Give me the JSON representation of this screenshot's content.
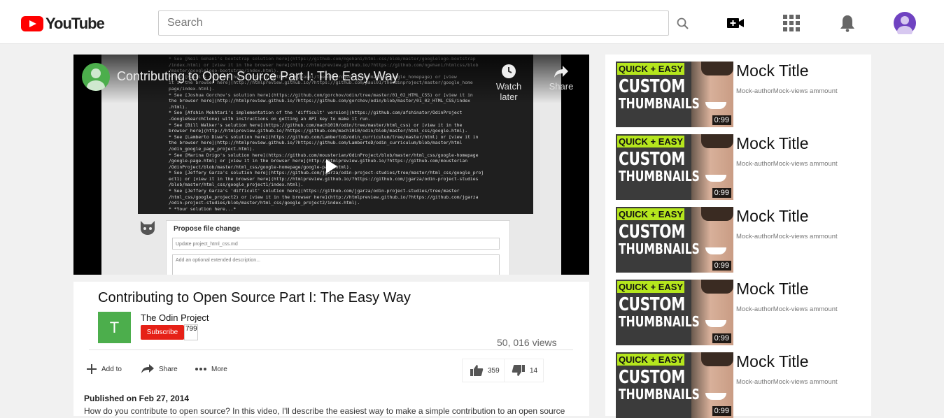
{
  "header": {
    "logo_text": "YouTube",
    "search_placeholder": "Search",
    "icons": [
      "youtube-logo-icon",
      "search-icon",
      "upload-video-icon",
      "apps-grid-icon",
      "notifications-bell-icon",
      "user-avatar-icon"
    ]
  },
  "player": {
    "title": "Contributing to Open Source Part I: The Easy Way",
    "watch_later_label": "Watch later",
    "share_label": "Share",
    "code_lines": [
      "* See [Neil Gehani's bootstrap solution here](https://github.com/ngehani/html-css/blob/master/googlelogo-bootstrap",
      "/index.html) or [view it in the browser here](http://htmlpreview.github.io/?https://github.com/ngehani/htmlcss/blob",
      "/master/googlelogo-bootstrap/index.html).",
      "* See [Pavol's solution here](https://github.com/pavol/theodinproject/tree/master/google_homepage) or [view",
      "it in the browser here](http://htmlpreview.github.io/?https://github.com/paul01/theodinproject/master/google_home",
      "page/index.html).",
      "* See [Joshua Gorchov's solution here](https://github.com/gorchov/odin/tree/master/01_02_HTML_CSS) or [view it in",
      "the browser here](http://htmlpreview.github.io/?https://github.com/gorchov/odin/blob/master/01_02_HTML_CSS/index",
      ".html).",
      "* See [Afshin Mokhtari's implementation of the 'difficult' version](https://github.com/afshinator/OdinProject",
      "-GoogleSearchClone) with instructions on getting an API key to make it run.",
      "* See [Bill Walker's solution here](https://github.com/mach1010/odin/tree/master/html_css) or [view it in the",
      "browser here](http://htmlpreview.github.io/?https://github.com/mach1010/odin/blob/master/html_css/google.html).",
      "* See [Lamberto Diwa's solution here](https://github.com/LambertoD/odin_curriculum/tree/master/html) or [view it in",
      "the browser here](http://htmlpreview.github.io/?https://github.com/LambertoD/odin_curriculum/blob/master/html",
      "/odin_google_page_project.html).",
      "* See [Marina Drigo's solution here](https://github.com/mousterian/OdinProject/blob/master/html_css/google-homepage",
      "/google-page.html) or [view it in the browser here](http://htmlpreview.github.io/?https://github.com/mousterian",
      "/OdinProject/blob/master/html_css/google-homepage/google-page.html).",
      "* See [Jeffery Garza's solution here](https://github.com/jgarza/odin-project-studies/tree/master/html_css/google_proj",
      "ect1) or [view it in the browser here](http://htmlpreview.github.io/?https://github.com/jgarza/odin-project-studies",
      "/blob/master/html_css/google_project1/index.html).",
      "* See [Jeffery Garza's 'difficult' solution here](https://github.com/jgarza/odin-project-studies/tree/master",
      "/html_css/google_project2) or [view it in the browser here](http://htmlpreview.github.io/?https://github.com/jgarza",
      "/odin-project-studies/blob/master/html_css/google_project2/index.html).",
      "* *Your solution here...*"
    ],
    "propose_title": "Propose file change",
    "propose_input_placeholder": "Update project_html_css.md",
    "propose_desc_placeholder": "Add an optional extended description..."
  },
  "video": {
    "title": "Contributing to Open Source Part I: The Easy Way",
    "channel_initial": "T",
    "channel_name": "The Odin Project",
    "subscribe_label": "Subscribe",
    "subscriber_count": "799",
    "views": "50, 016 views",
    "actions": {
      "add_to": "Add to",
      "share": "Share",
      "more": "More",
      "likes": "359",
      "dislikes": "14"
    },
    "published": "Published on Feb 27, 2014",
    "description": "How do you contribute to open source? In this video, I'll describe the easiest way to make a simple contribution to an open source"
  },
  "related": [
    {
      "title": "Mock Title",
      "meta": "Mock-authorMock-views ammount",
      "duration": "0:99",
      "thumb_line1": "QUICK + EASY",
      "thumb_line2": "CUSTOM",
      "thumb_line3": "THUMBNAILS"
    },
    {
      "title": "Mock Title",
      "meta": "Mock-authorMock-views ammount",
      "duration": "0:99",
      "thumb_line1": "QUICK + EASY",
      "thumb_line2": "CUSTOM",
      "thumb_line3": "THUMBNAILS"
    },
    {
      "title": "Mock Title",
      "meta": "Mock-authorMock-views ammount",
      "duration": "0:99",
      "thumb_line1": "QUICK + EASY",
      "thumb_line2": "CUSTOM",
      "thumb_line3": "THUMBNAILS"
    },
    {
      "title": "Mock Title",
      "meta": "Mock-authorMock-views ammount",
      "duration": "0:99",
      "thumb_line1": "QUICK + EASY",
      "thumb_line2": "CUSTOM",
      "thumb_line3": "THUMBNAILS"
    },
    {
      "title": "Mock Title",
      "meta": "Mock-authorMock-views ammount",
      "duration": "0:99",
      "thumb_line1": "QUICK + EASY",
      "thumb_line2": "CUSTOM",
      "thumb_line3": "THUMBNAILS"
    }
  ],
  "colors": {
    "brand_red": "#ff0000",
    "subscribe_red": "#e62117",
    "channel_green": "#4cae4c",
    "avatar_purple": "#6f42c1",
    "thumb_green": "#b5e61d"
  }
}
